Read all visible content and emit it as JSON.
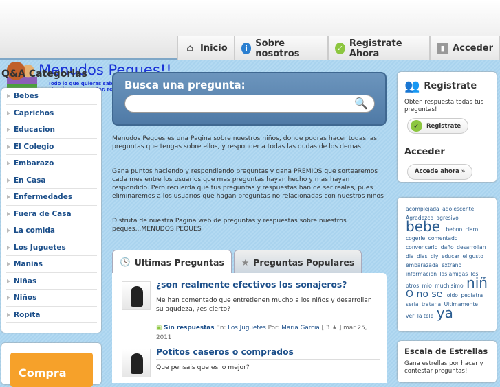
{
  "nav": [
    {
      "label": "Inicio",
      "icon": "home-icon"
    },
    {
      "label": "Sobre nosotros",
      "icon": "info-icon"
    },
    {
      "label": "Registrate Ahora",
      "icon": "check-icon"
    },
    {
      "label": "Acceder",
      "icon": "lock-icon"
    }
  ],
  "logo": {
    "name": "Menudos Peques!!",
    "tagline": "Todo lo que quieras saber sobre tus hijos y no te atrevias a preguntar, respuestas"
  },
  "categories": {
    "title": "Q&A Categorias",
    "items": [
      "Bebes",
      "Caprichos",
      "Educacion",
      "El Colegio",
      "Embarazo",
      "En Casa",
      "Enfermedades",
      "Fuera de Casa",
      "La comida",
      "Los Juguetes",
      "Manias",
      "Niñas",
      "Niños",
      "Ropita"
    ]
  },
  "promo": {
    "label": "Compra"
  },
  "search": {
    "title": "Busca una pregunta:",
    "value": "",
    "placeholder": ""
  },
  "intro": [
    "Menudos Peques es una Pagina sobre nuestros niños, donde podras hacer todas las preguntas que tengas sobre ellos, y responder a todas las dudas de los demas.",
    "Gana puntos haciendo y respondiendo preguntas y gana PREMIOS que sortearemos cada mes entre los usuarios que mas preguntas hayan hecho y mas hayan respondido. Pero recuerda que tus preguntas y respuestas han de ser reales, pues eliminaremos a los usuarios que hagan preguntas no relacionadas con nuestros niños",
    "Disfruta de nuestra Pagina web de preguntas y respuestas sobre nuestros peques...MENUDOS PEQUES"
  ],
  "tabs": [
    {
      "label": "Ultimas Preguntas",
      "active": true
    },
    {
      "label": "Preguntas Populares",
      "active": false
    }
  ],
  "questions": [
    {
      "title": "¿son realmente efectivos los sonajeros?",
      "body": "Me han comentado que entretienen mucho a los niños y desarrollan su agudeza, ¿es cierto?",
      "status": "Sin respuestas",
      "in_label": "En:",
      "category": "Los Juguetes",
      "by_label": "Por:",
      "author": "Maria Garcia",
      "points": "[ 3 ★ ]",
      "date": "mar 25, 2011"
    },
    {
      "title": "Potitos caseros o comprados",
      "body": "Que pensais que es lo mejor?"
    }
  ],
  "register": {
    "title": "Registrate",
    "text": "Obten respuesta todas tus preguntas!",
    "button": "Registrate",
    "login_title": "Acceder",
    "login_button": "Accede ahora »"
  },
  "tag_cloud": [
    [
      "acomplejada",
      1
    ],
    [
      "adolescente",
      1
    ],
    [
      "Agradezco",
      1
    ],
    [
      "agresivo",
      1
    ],
    [
      "bebe",
      3
    ],
    [
      "bebno",
      1
    ],
    [
      "claro",
      1
    ],
    [
      "cogerle",
      1
    ],
    [
      "comentado",
      1
    ],
    [
      "convencerlo",
      1
    ],
    [
      "daño",
      1
    ],
    [
      "desarrollan",
      1
    ],
    [
      "dia",
      1
    ],
    [
      "dias",
      1
    ],
    [
      "diy",
      1
    ],
    [
      "educar",
      1
    ],
    [
      "el gusto",
      1
    ],
    [
      "embarazada",
      1
    ],
    [
      "extraño",
      1
    ],
    [
      "informacion",
      1
    ],
    [
      "las amigas",
      1
    ],
    [
      "los",
      1
    ],
    [
      "otros",
      1
    ],
    [
      "mio",
      1
    ],
    [
      "muchisimo",
      1
    ],
    [
      "niñ",
      3
    ],
    [
      "O no se",
      2
    ],
    [
      "oido",
      1
    ],
    [
      "pediatra",
      1
    ],
    [
      "seria",
      1
    ],
    [
      "tratarla",
      1
    ],
    [
      "Ultimamente",
      1
    ],
    [
      "ver",
      1
    ],
    [
      "la tele",
      1
    ],
    [
      "ya",
      3
    ]
  ],
  "stars": {
    "title": "Escala de Estrellas",
    "text": "Gana estrellas por hacer y contestar preguntas!"
  },
  "colors": {
    "link": "#1c4f8a",
    "accent": "#f6a12a",
    "search_bg": "#5a85b0"
  }
}
